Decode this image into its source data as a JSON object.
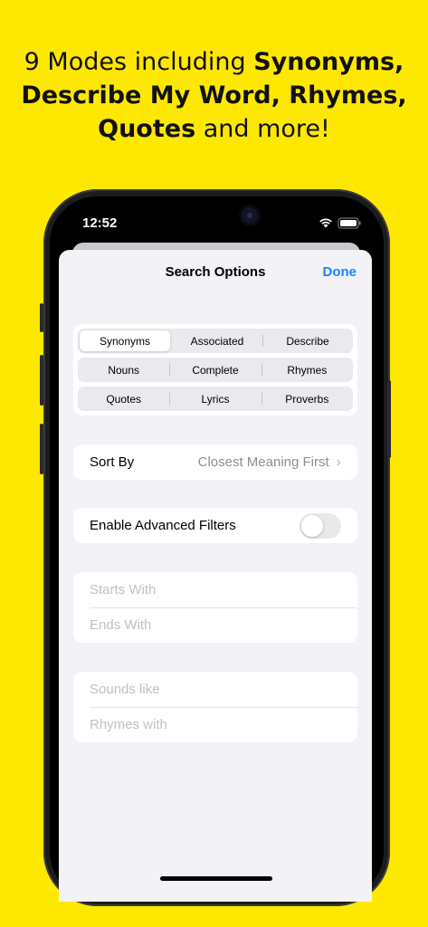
{
  "headline": {
    "line1_plain": "9 Modes including ",
    "line1_bold": "Synonyms,",
    "line2_bold": "Describe My Word, Rhymes,",
    "line3_bold": "Quotes",
    "line3_plain": " and more!"
  },
  "status_bar": {
    "time": "12:52"
  },
  "sheet": {
    "title": "Search Options",
    "done_label": "Done"
  },
  "modes": {
    "selected": "Synonyms",
    "rows": [
      [
        "Synonyms",
        "Associated",
        "Describe"
      ],
      [
        "Nouns",
        "Complete",
        "Rhymes"
      ],
      [
        "Quotes",
        "Lyrics",
        "Proverbs"
      ]
    ]
  },
  "sort": {
    "label": "Sort By",
    "value": "Closest Meaning First"
  },
  "advanced_filters": {
    "label": "Enable Advanced Filters",
    "enabled": false
  },
  "filters_group1": {
    "starts_with_placeholder": "Starts With",
    "ends_with_placeholder": "Ends With"
  },
  "filters_group2": {
    "sounds_like_placeholder": "Sounds like",
    "rhymes_with_placeholder": "Rhymes with"
  },
  "colors": {
    "background": "#FFE800",
    "accent": "#1A84FF",
    "sheet_bg": "#F2F2F7"
  }
}
